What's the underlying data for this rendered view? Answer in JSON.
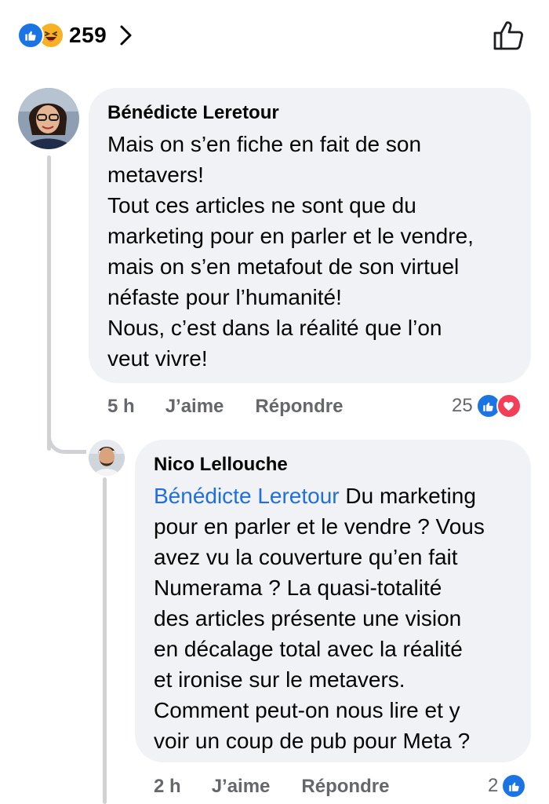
{
  "reactions": {
    "count": "259",
    "icons": [
      "like-icon",
      "haha-icon"
    ],
    "colors": {
      "like": "#1b74e4",
      "haha": "#f7b125"
    }
  },
  "comments": [
    {
      "author": "Bénédicte Leretour",
      "text": "Mais on s’en fiche en fait de son\nmetavers!\nTout ces articles ne sont que du\nmarketing pour en parler et le vendre,\nmais on s’en metafout de son virtuel\nnéfaste pour l’humanité!\nNous, c’est dans la réalité que l’on\nveut vivre!",
      "time": "5 h",
      "like_label": "J’aime",
      "reply_label": "Répondre",
      "reaction_count": "25",
      "reaction_icons": [
        "like-icon",
        "love-icon"
      ]
    },
    {
      "author": "Nico Lellouche",
      "mention": "Bénédicte Leretour",
      "text": " Du marketing\npour en parler et le vendre ? Vous\navez vu la couverture qu’en fait\nNumerama ? La quasi-totalité\ndes articles présente une vision\nen décalage total avec la réalité\net ironise sur le metavers.\nComment peut-on nous lire et y\nvoir un coup de pub pour Meta ?",
      "time": "2 h",
      "like_label": "J’aime",
      "reply_label": "Répondre",
      "reaction_count": "2",
      "reaction_icons": [
        "like-icon"
      ]
    }
  ],
  "colors": {
    "bubble": "#f0f2f5",
    "mention": "#216fdb",
    "meta_text": "#65676b",
    "thread_line": "#d0d2d6"
  }
}
